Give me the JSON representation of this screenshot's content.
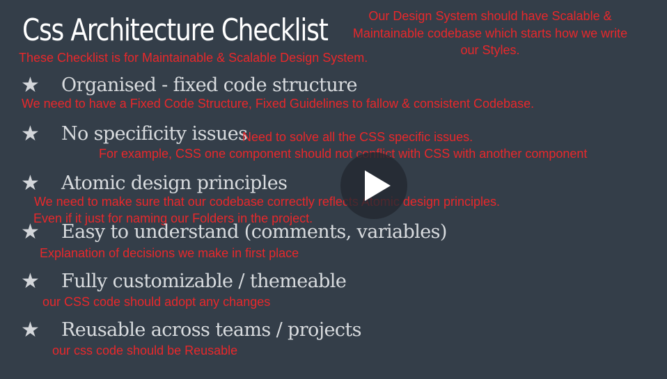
{
  "slide": {
    "title": "Css Architecture Checklist",
    "note_top": "Our Design System should have Scalable & Maintainable codebase which starts how we write our  Styles.",
    "note_sub": "These Checklist is for Maintainable & Scalable Design System."
  },
  "checklist": [
    {
      "icon": "star-icon",
      "label": "Organised - fixed code structure",
      "notes": [
        "We need to have a Fixed Code Structure, Fixed Guidelines to fallow & consistent Codebase."
      ]
    },
    {
      "icon": "star-icon",
      "label": "No specificity issues",
      "notes": [
        "Need to solve all the CSS specific issues.",
        "For example, CSS one component should not conflict with CSS with another component"
      ]
    },
    {
      "icon": "star-icon",
      "label": "Atomic design principles",
      "notes": [
        "We need to make sure that our codebase correctly reflects Atomic design principles.",
        "Even if it just for naming our  Folders in the project."
      ]
    },
    {
      "icon": "star-icon",
      "label": "Easy to understand (comments, variables)",
      "notes": [
        "Explanation of decisions we make in first place"
      ]
    },
    {
      "icon": "star-icon",
      "label": "Fully customizable / themeable",
      "notes": [
        "our CSS code should adopt any changes"
      ]
    },
    {
      "icon": "star-icon",
      "label": "Reusable across teams / projects",
      "notes": [
        "our css code should be Reusable"
      ]
    }
  ],
  "player": {
    "icon": "play-icon"
  },
  "colors": {
    "background": "#343e49",
    "title": "#ffffff",
    "item_text": "#d9dcdf",
    "annotation": "#e8282b",
    "play_button": "#22282f"
  }
}
